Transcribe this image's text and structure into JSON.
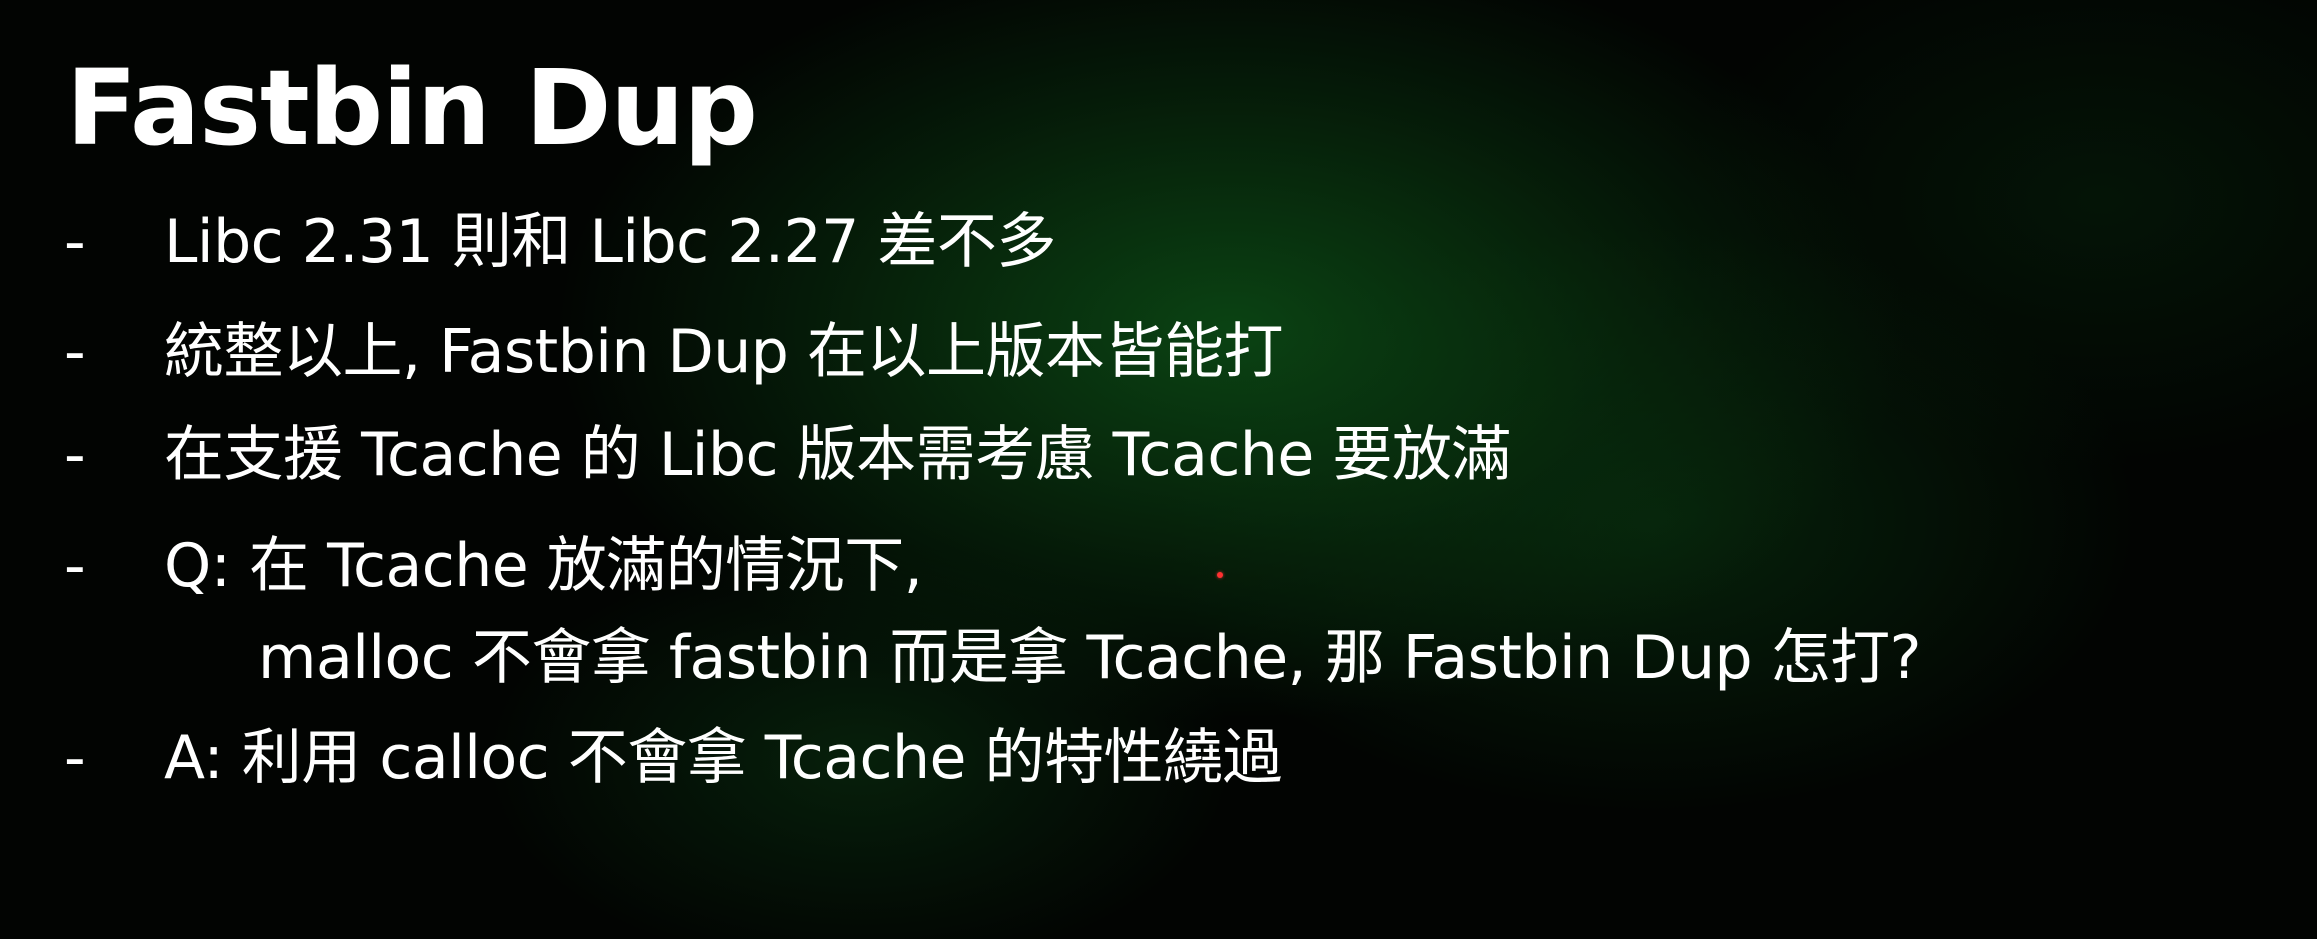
{
  "slide": {
    "title": "Fastbin Dup",
    "bullet_marker": "-",
    "bullets": [
      {
        "text": "Libc 2.31 則和 Libc 2.27 差不多"
      },
      {
        "text": "統整以上, Fastbin Dup 在以上版本皆能打"
      },
      {
        "text": "在支援 Tcache 的 Libc 版本需考慮 Tcache 要放滿"
      },
      {
        "text": "Q: 在 Tcache 放滿的情況下,",
        "continuation": "malloc 不會拿 fastbin 而是拿 Tcache, 那 Fastbin Dup 怎打?"
      },
      {
        "text": "A: 利用 calloc 不會拿 Tcache 的特性繞過"
      }
    ]
  },
  "colors": {
    "text": "#ffffff",
    "background": "#020402",
    "glow": "#0c4e16",
    "pointer": "#ff3030"
  }
}
